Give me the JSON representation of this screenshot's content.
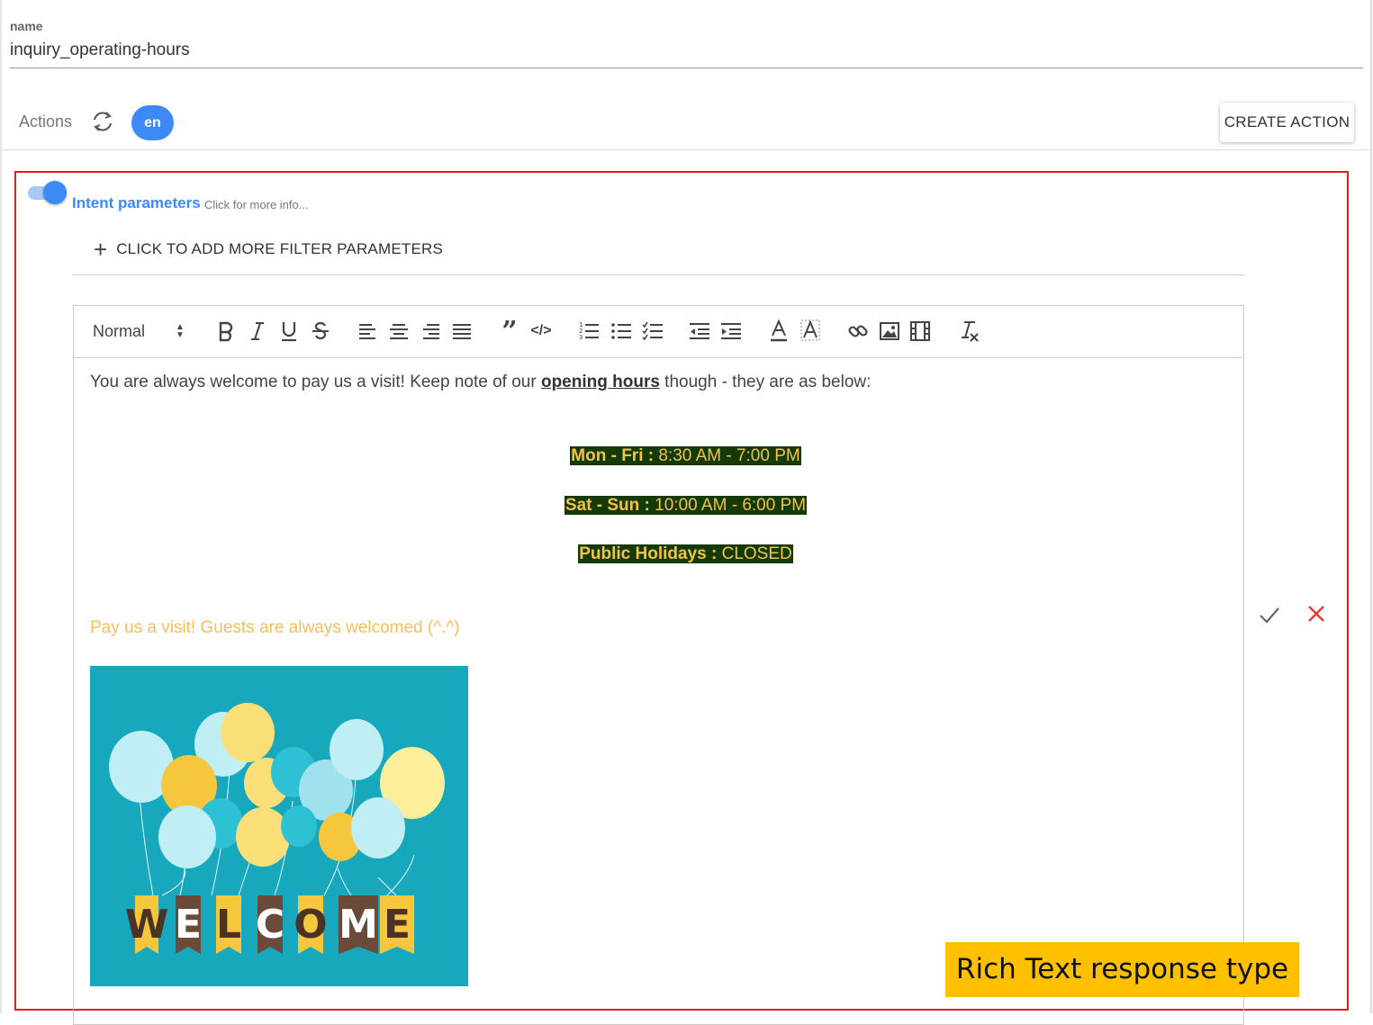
{
  "form": {
    "name_label": "name",
    "name_value": "inquiry_operating-hours"
  },
  "actions_bar": {
    "label": "Actions",
    "language_chip": "en",
    "create_button": "CREATE ACTION"
  },
  "intent_params": {
    "toggle_on": true,
    "title": "Intent parameters",
    "hint": "Click for more info...",
    "add_filter_label": "CLICK TO ADD MORE FILTER PARAMETERS"
  },
  "toolbar": {
    "format_select": "Normal",
    "icons": [
      "bold-icon",
      "italic-icon",
      "underline-icon",
      "strikethrough-icon",
      "align-left-icon",
      "align-center-icon",
      "align-right-icon",
      "align-justify-icon",
      "blockquote-icon",
      "code-block-icon",
      "ordered-list-icon",
      "bullet-list-icon",
      "checklist-icon",
      "outdent-icon",
      "indent-icon",
      "text-color-icon",
      "background-color-icon",
      "link-icon",
      "image-icon",
      "video-icon",
      "clear-format-icon"
    ]
  },
  "content": {
    "intro_before": "You are always welcome to pay us a visit! Keep note of our ",
    "intro_bold": "opening hours",
    "intro_after": " though - they are as below:",
    "hours": [
      {
        "label": "Mon - Fri :",
        "value": " 8:30 AM - 7:00 PM"
      },
      {
        "label": "Sat - Sun :",
        "value": " 10:00 AM - 6:00 PM"
      },
      {
        "label": "Public Holidays :",
        "value": " CLOSED"
      }
    ],
    "visit_text": "Pay us a visit! Guests are always welcomed (^.^)",
    "image_letters": [
      "W",
      "E",
      "L",
      "C",
      "O",
      "M",
      "E"
    ]
  },
  "caption": "Rich Text response type",
  "colors": {
    "accent": "#3d8af7",
    "highlight_border": "#e02020",
    "hours_bg": "#143a08",
    "hours_text": "#f5c146",
    "visit_text": "#f7be5c",
    "caption_bg": "#ffc000",
    "image_bg": "#17a8bd"
  }
}
